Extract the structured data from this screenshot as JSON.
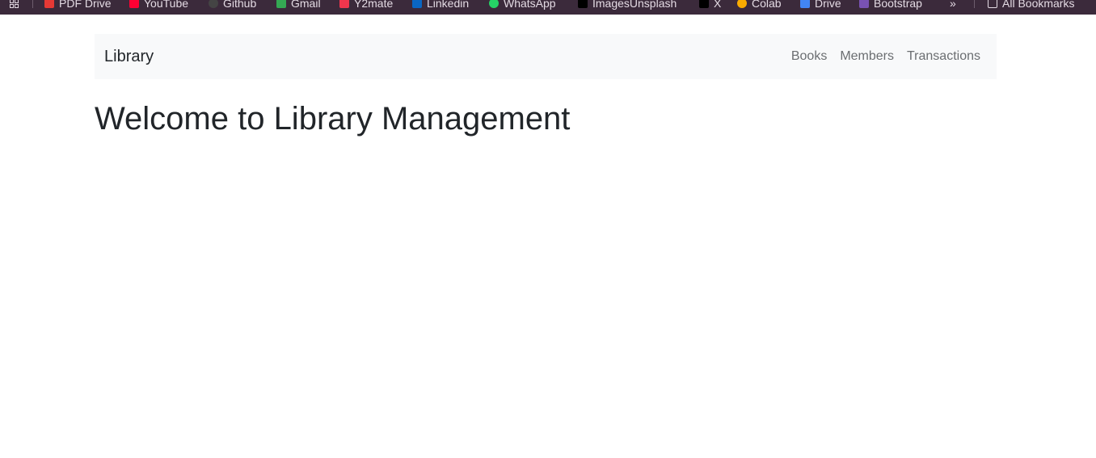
{
  "bookmarks_bar": {
    "items": [
      {
        "label": "PDF Drive",
        "icon": "pdf-drive-icon",
        "color": "#e53935"
      },
      {
        "label": "YouTube",
        "icon": "youtube-icon",
        "color": "#ff0033"
      },
      {
        "label": "Github",
        "icon": "github-icon",
        "color": "#444444"
      },
      {
        "label": "Gmail",
        "icon": "gmail-icon",
        "color": "#34a853"
      },
      {
        "label": "Y2mate",
        "icon": "y2mate-icon",
        "color": "#f0364d"
      },
      {
        "label": "Linkedin",
        "icon": "linkedin-icon",
        "color": "#0a66c2"
      },
      {
        "label": "WhatsApp",
        "icon": "whatsapp-icon",
        "color": "#25d366"
      },
      {
        "label": "ImagesUnsplash",
        "icon": "unsplash-icon",
        "color": "#000000"
      },
      {
        "label": "X",
        "icon": "x-icon",
        "color": "#000000"
      },
      {
        "label": "Colab",
        "icon": "colab-icon",
        "color": "#f9ab00"
      },
      {
        "label": "Drive",
        "icon": "drive-icon",
        "color": "#4285f4"
      },
      {
        "label": "Bootstrap",
        "icon": "bootstrap-icon",
        "color": "#7952b3"
      }
    ],
    "overflow_label": "»",
    "all_bookmarks_label": "All Bookmarks"
  },
  "navbar": {
    "brand": "Library",
    "links": [
      {
        "label": "Books"
      },
      {
        "label": "Members"
      },
      {
        "label": "Transactions"
      }
    ]
  },
  "main": {
    "title": "Welcome to Library Management"
  },
  "colors": {
    "bookmarks_bg": "#3b2a3b",
    "navbar_bg": "#f8f9fa",
    "text": "#212529",
    "nav_link": "#6b6e71"
  }
}
